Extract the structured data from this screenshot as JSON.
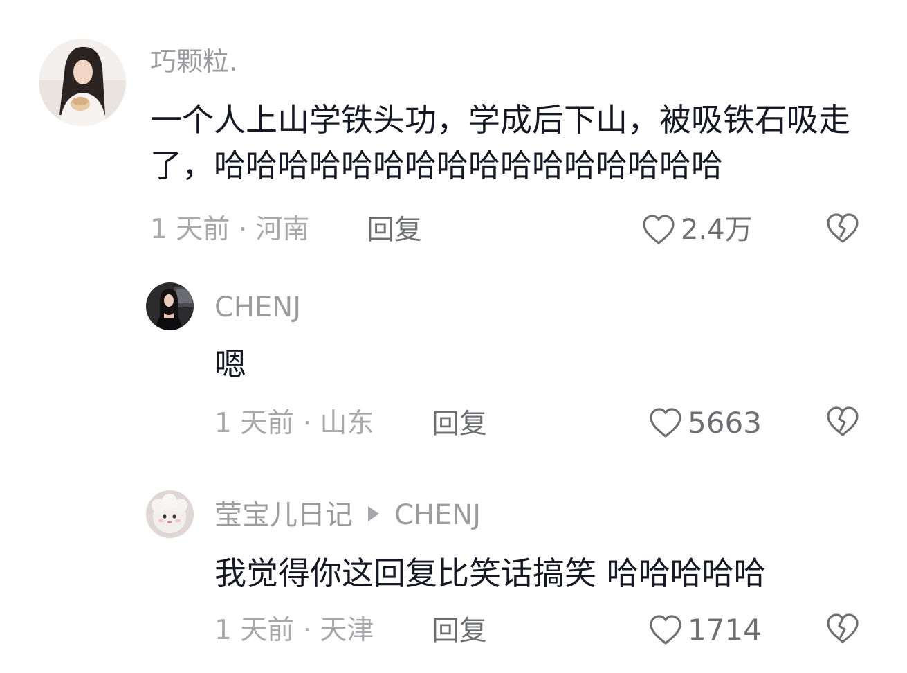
{
  "comments": [
    {
      "username": "巧颗粒.",
      "text": "一个人上山学铁头功，学成后下山，被吸铁石吸走了，哈哈哈哈哈哈哈哈哈哈哈哈哈哈哈哈",
      "meta": "1 天前 · 河南",
      "reply_label": "回复",
      "likes": "2.4万"
    },
    {
      "username": "CHENJ",
      "text": "嗯",
      "meta": "1 天前 · 山东",
      "reply_label": "回复",
      "likes": "5663"
    },
    {
      "username": "莹宝儿日记",
      "reply_to": "CHENJ",
      "text": "我觉得你这回复比笑话搞笑 哈哈哈哈哈",
      "meta": "1 天前 · 天津",
      "reply_label": "回复",
      "likes": "1714"
    }
  ],
  "icons": {
    "like": "heart-outline-icon",
    "dislike": "broken-heart-icon",
    "reply_arrow": "triangle-right-icon"
  },
  "colors": {
    "text": "#161823",
    "username": "#9b9ba0",
    "meta": "#a8a8ad",
    "action": "#6e6f73"
  }
}
